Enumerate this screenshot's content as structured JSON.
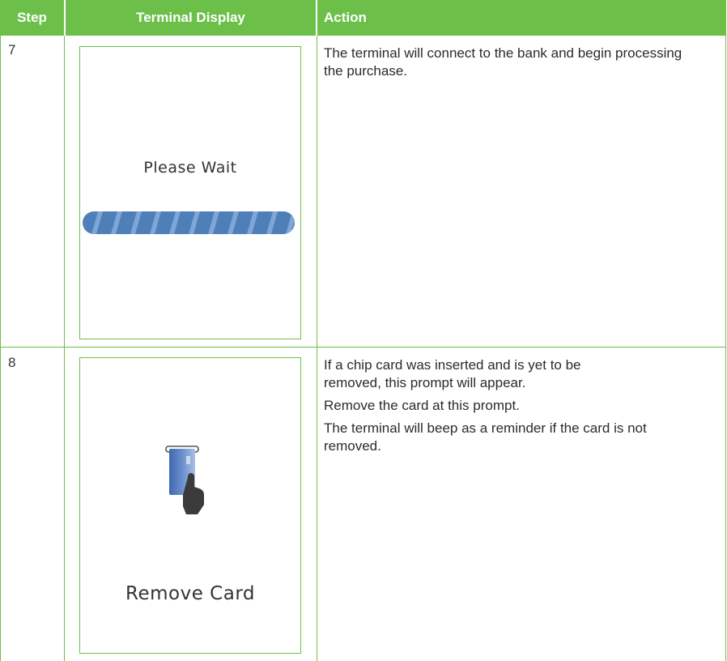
{
  "headers": {
    "step": "Step",
    "display": "Terminal Display",
    "action": "Action"
  },
  "rows": [
    {
      "step": "7",
      "screen_text": "Please Wait",
      "action": [
        "The terminal will connect to the bank and begin processing the purchase."
      ]
    },
    {
      "step": "8",
      "screen_text": "Remove Card",
      "action": [
        "If a chip card was inserted and is yet to be removed, this prompt will appear.",
        "Remove the card at this prompt.",
        "The terminal will beep as a reminder if the card is not removed."
      ]
    }
  ],
  "colors": {
    "header_bg": "#6cc04a",
    "border": "#6cc04a",
    "progress_bar": "#4f7fb8",
    "card": "#3f68b0"
  },
  "icons": [
    "progress-bar-icon",
    "card-removal-icon"
  ]
}
